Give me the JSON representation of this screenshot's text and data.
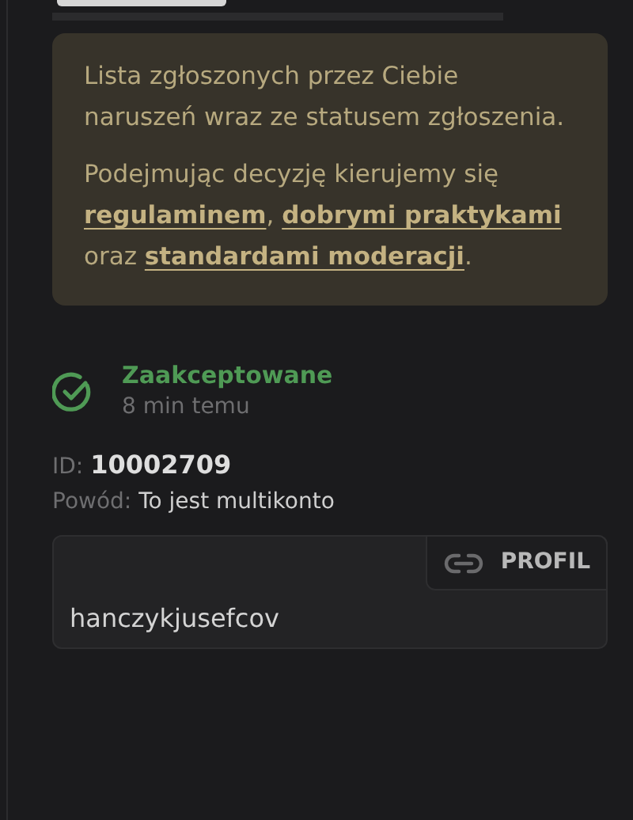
{
  "info": {
    "paragraphs": [
      [
        {
          "kind": "text",
          "text": "Lista zgłoszonych przez Ciebie naruszeń wraz ze statusem zgłoszenia."
        }
      ],
      [
        {
          "kind": "text",
          "text": "Podejmując decyzję kierujemy się "
        },
        {
          "kind": "link",
          "text": "regulaminem"
        },
        {
          "kind": "text",
          "text": ", "
        },
        {
          "kind": "link",
          "text": "dobrymi praktykami"
        },
        {
          "kind": "text",
          "text": " oraz "
        },
        {
          "kind": "link",
          "text": "standardami moderacji"
        },
        {
          "kind": "text",
          "text": "."
        }
      ]
    ]
  },
  "report": {
    "status": {
      "kind": "accepted",
      "label": "Zaakceptowane",
      "time": "8 min temu"
    },
    "id_label": "ID:",
    "id": "10002709",
    "reason_label": "Powód:",
    "reason": "To jest multikonto",
    "target": {
      "button": "PROFIL",
      "username": "hanczykjusefcov"
    }
  }
}
